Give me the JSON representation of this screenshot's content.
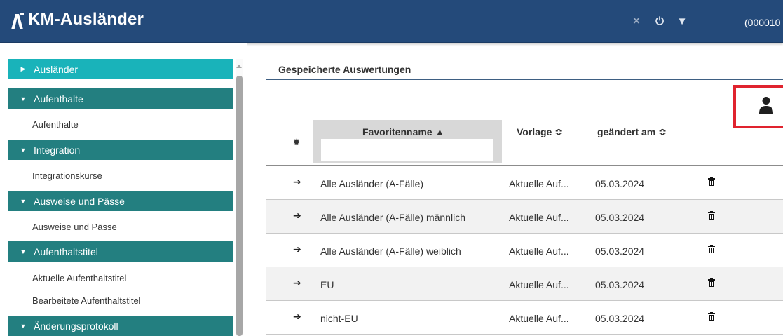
{
  "header": {
    "app_title": "KM-Ausländer",
    "close_symbol": "×",
    "power_symbol": "⏻",
    "menu_symbol": "▼",
    "user_id": "(000010"
  },
  "sidebar": {
    "groups": [
      {
        "label": "Ausländer",
        "expanded": false,
        "active": true,
        "items": []
      },
      {
        "label": "Aufenthalte",
        "expanded": true,
        "items": [
          "Aufenthalte"
        ]
      },
      {
        "label": "Integration",
        "expanded": true,
        "items": [
          "Integrationskurse"
        ]
      },
      {
        "label": "Ausweise und Pässe",
        "expanded": true,
        "items": [
          "Ausweise und Pässe"
        ]
      },
      {
        "label": "Aufenthaltstitel",
        "expanded": true,
        "items": [
          "Aktuelle Aufenthaltstitel",
          "Bearbeitete Aufenthaltstitel"
        ]
      },
      {
        "label": "Änderungsprotokoll",
        "expanded": true,
        "items": []
      }
    ]
  },
  "main": {
    "section_title": "Gespeicherte Auswertungen",
    "columns": {
      "favoritenname": "Favoritenname ▲",
      "vorlage": "Vorlage ≎",
      "geaendert": "geändert am ≎"
    },
    "filter_value": "",
    "rows": [
      {
        "name": "Alle Ausländer (A-Fälle)",
        "vorlage": "Aktuelle Auf...",
        "date": "05.03.2024"
      },
      {
        "name": "Alle Ausländer (A-Fälle) männlich",
        "vorlage": "Aktuelle Auf...",
        "date": "05.03.2024"
      },
      {
        "name": "Alle Ausländer (A-Fälle) weiblich",
        "vorlage": "Aktuelle Auf...",
        "date": "05.03.2024"
      },
      {
        "name": "EU",
        "vorlage": "Aktuelle Auf...",
        "date": "05.03.2024"
      },
      {
        "name": "nicht-EU",
        "vorlage": "Aktuelle Auf...",
        "date": "05.03.2024"
      }
    ]
  },
  "colors": {
    "header_bg": "#244a7a",
    "nav_header": "#237f80",
    "nav_header_active": "#19b3ba",
    "highlight_border": "#e0232e"
  },
  "icons": {
    "logo": "logo-a-icon",
    "close": "close-icon",
    "power": "power-icon",
    "menu": "triangle-down-icon",
    "user": "user-icon",
    "gear": "gear-icon",
    "row_open": "arrow-right-icon",
    "row_delete": "trash-icon",
    "nav_collapsed": "caret-right-icon",
    "nav_expanded": "caret-down-icon"
  }
}
